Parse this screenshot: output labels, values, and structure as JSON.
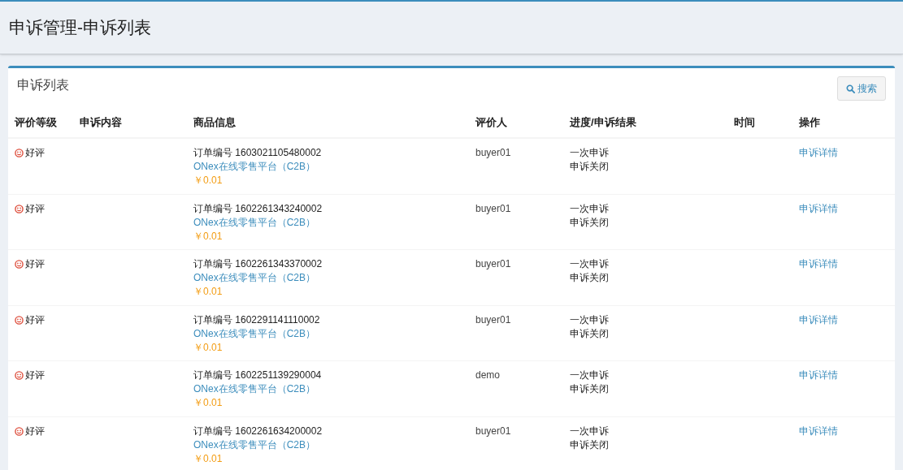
{
  "page_title": "申诉管理-申诉列表",
  "panel": {
    "title": "申诉列表",
    "search_button": "搜索"
  },
  "table": {
    "columns": [
      "评价等级",
      "申诉内容",
      "商品信息",
      "评价人",
      "进度/申诉结果",
      "时间",
      "操作"
    ],
    "rows": [
      {
        "rating": "好评",
        "order": "订单编号 1603021105480002",
        "product": "ONex在线零售平台（C2B）",
        "price": "￥0.01",
        "reviewer": "buyer01",
        "progress": "一次申诉",
        "result": "申诉关闭",
        "action": "申诉详情"
      },
      {
        "rating": "好评",
        "order": "订单编号 1602261343240002",
        "product": "ONex在线零售平台（C2B）",
        "price": "￥0.01",
        "reviewer": "buyer01",
        "progress": "一次申诉",
        "result": "申诉关闭",
        "action": "申诉详情"
      },
      {
        "rating": "好评",
        "order": "订单编号 1602261343370002",
        "product": "ONex在线零售平台（C2B）",
        "price": "￥0.01",
        "reviewer": "buyer01",
        "progress": "一次申诉",
        "result": "申诉关闭",
        "action": "申诉详情"
      },
      {
        "rating": "好评",
        "order": "订单编号 1602291141110002",
        "product": "ONex在线零售平台（C2B）",
        "price": "￥0.01",
        "reviewer": "buyer01",
        "progress": "一次申诉",
        "result": "申诉关闭",
        "action": "申诉详情"
      },
      {
        "rating": "好评",
        "order": "订单编号 1602251139290004",
        "product": "ONex在线零售平台（C2B）",
        "price": "￥0.01",
        "reviewer": "demo",
        "progress": "一次申诉",
        "result": "申诉关闭",
        "action": "申诉详情"
      },
      {
        "rating": "好评",
        "order": "订单编号 1602261634200002",
        "product": "ONex在线零售平台（C2B）",
        "price": "￥0.01",
        "reviewer": "buyer01",
        "progress": "一次申诉",
        "result": "申诉关闭",
        "action": "申诉详情"
      }
    ]
  }
}
